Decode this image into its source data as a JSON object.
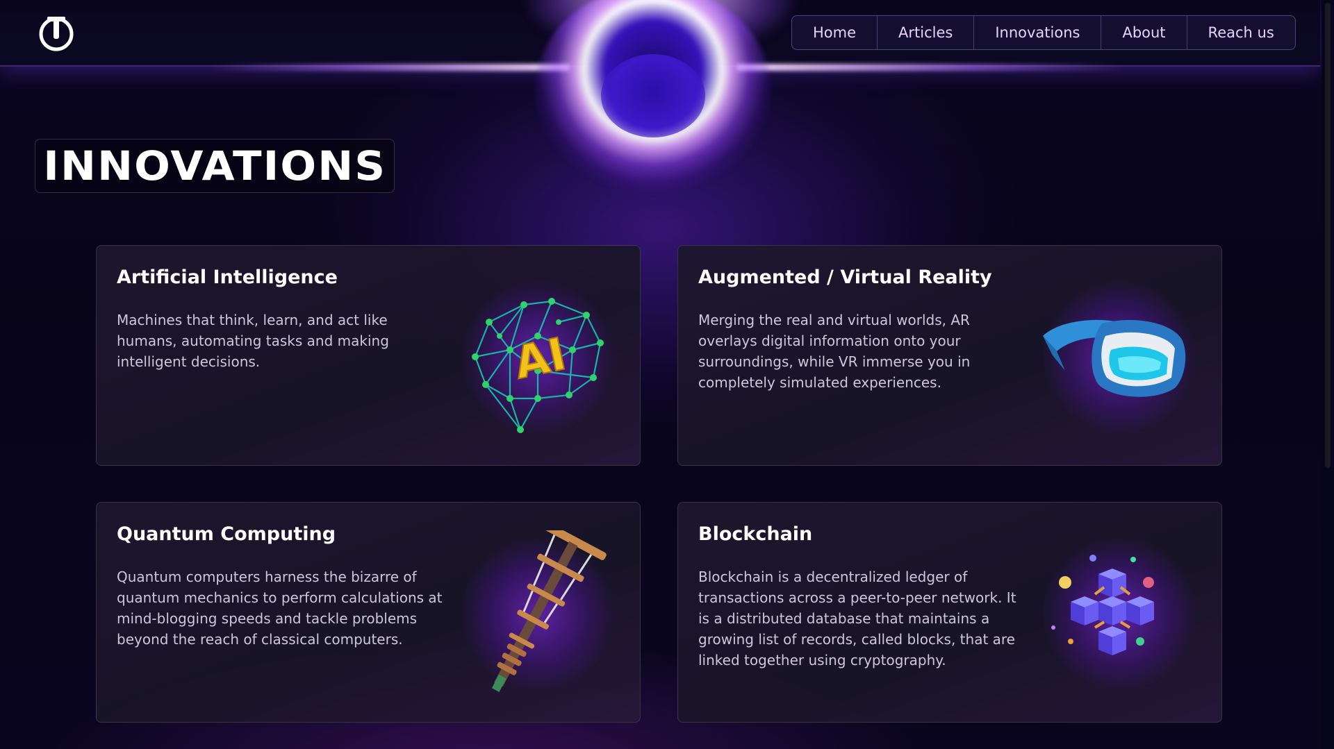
{
  "nav": {
    "items": [
      {
        "label": "Home"
      },
      {
        "label": "Articles"
      },
      {
        "label": "Innovations"
      },
      {
        "label": "About"
      },
      {
        "label": "Reach us"
      }
    ]
  },
  "page": {
    "title": "INNOVATIONS"
  },
  "cards": [
    {
      "title": "Artificial Intelligence",
      "text": "Machines that think, learn, and act like humans, automating tasks and making intelligent decisions.",
      "icon": "ai-brain-icon",
      "art_text": "AI"
    },
    {
      "title": "Augmented / Virtual Reality",
      "text": "Merging the real and virtual worlds, AR overlays digital information onto your surroundings, while VR immerse you in completely simulated experiences.",
      "icon": "vr-headset-icon"
    },
    {
      "title": "Quantum Computing",
      "text": "Quantum computers harness the bizarre of quantum mechanics to perform calculations at mind-blogging speeds and tackle problems beyond the reach of classical computers.",
      "icon": "quantum-computer-icon"
    },
    {
      "title": "Blockchain",
      "text": "Blockchain is a decentralized ledger of transactions across a peer-to-peer network. It is a distributed database that maintains a growing list of records, called blocks, that are linked together using cryptography.",
      "icon": "blockchain-cubes-icon"
    }
  ],
  "colors": {
    "background": "#07051a",
    "nav_text": "#e6d3ff",
    "accent_purple": "#7b3cff",
    "card_text": "#cdc8d8"
  }
}
